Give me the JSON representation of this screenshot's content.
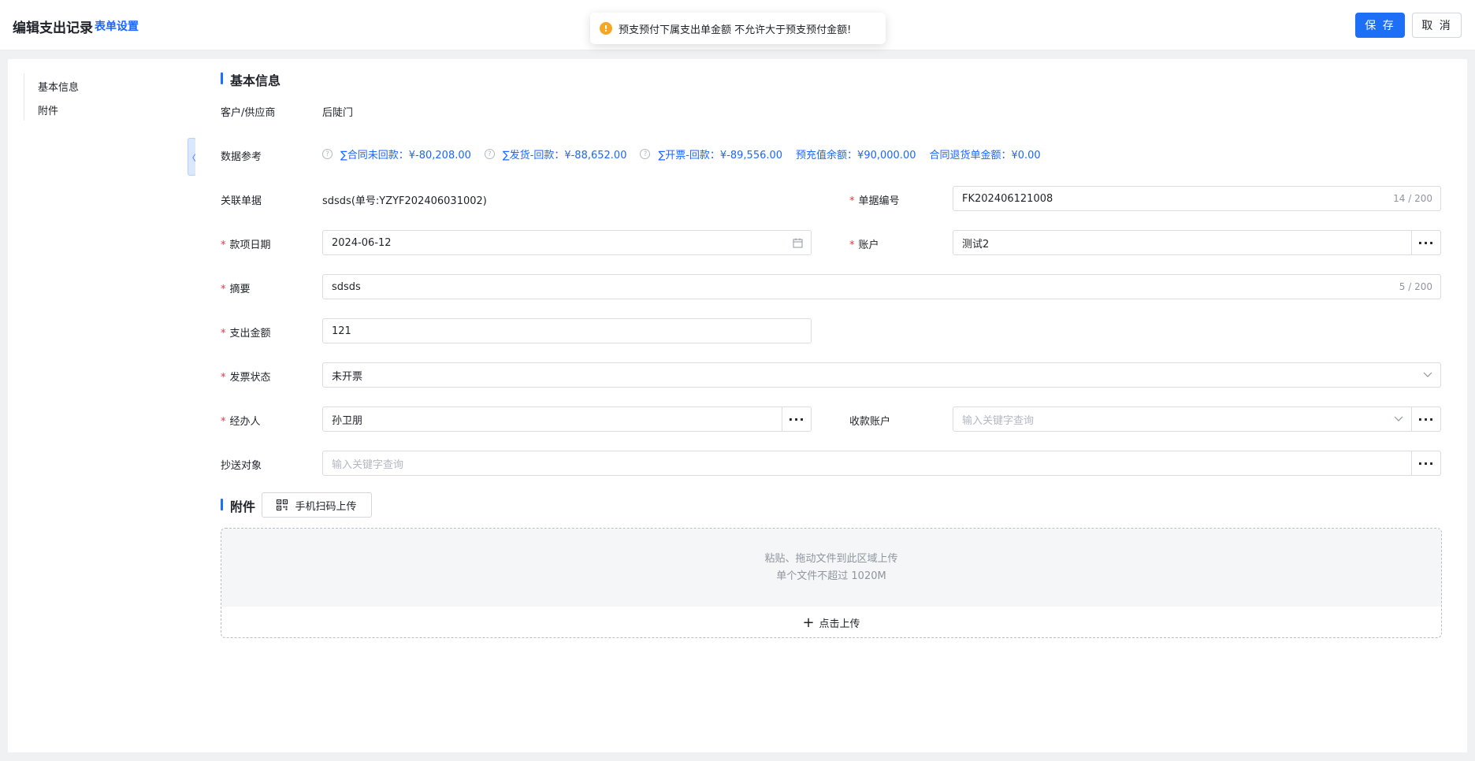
{
  "header": {
    "title": "编辑支出记录",
    "settings_link": "表单设置",
    "save_label": "保 存",
    "cancel_label": "取 消"
  },
  "toast": {
    "icon": "warning-icon",
    "message": "预支预付下属支出单金额 不允许大于预支预付金额!"
  },
  "nav": {
    "items": [
      {
        "label": "基本信息"
      },
      {
        "label": "附件"
      }
    ],
    "collapse_glyph": "〈"
  },
  "basic": {
    "section_title": "基本信息",
    "customer": {
      "label": "客户/供应商",
      "value": "后陡门"
    },
    "data_ref": {
      "label": "数据参考",
      "items": [
        {
          "text": "∑合同未回款：¥-80,208.00",
          "help": true
        },
        {
          "text": "∑发货-回款：¥-88,652.00",
          "help": true
        },
        {
          "text": "∑开票-回款：¥-89,556.00",
          "help": true
        },
        {
          "text": "预充值余额：¥90,000.00",
          "help": false
        },
        {
          "text": "合同退货单金额：¥0.00",
          "help": false
        }
      ]
    },
    "related_doc": {
      "label": "关联单据",
      "value": "sdsds(单号:YZYF202406031002)"
    },
    "doc_no": {
      "label": "单据编号",
      "value": "FK202406121008",
      "counter": "14 / 200"
    },
    "date": {
      "label": "款项日期",
      "value": "2024-06-12"
    },
    "account": {
      "label": "账户",
      "value": "测试2"
    },
    "summary": {
      "label": "摘要",
      "value": "sdsds",
      "counter": "5 / 200"
    },
    "amount": {
      "label": "支出金额",
      "value": "121"
    },
    "invoice_status": {
      "label": "发票状态",
      "value": "未开票"
    },
    "handler": {
      "label": "经办人",
      "value": "孙卫朋"
    },
    "payee_account": {
      "label": "收款账户",
      "placeholder": "输入关键字查询"
    },
    "cc": {
      "label": "抄送对象",
      "placeholder": "输入关键字查询"
    },
    "required_mark": "*",
    "more_glyph": "···"
  },
  "attachments": {
    "section_title": "附件",
    "scan_button": "手机扫码上传",
    "drop_hint": "粘贴、拖动文件到此区域上传",
    "size_hint": "单个文件不超过 1020M",
    "upload_plus": "+",
    "upload_label": "点击上传"
  },
  "colors": {
    "primary": "#1d6ff5",
    "link": "#1a66ff",
    "required": "#e5383b",
    "warning": "#f5a623"
  }
}
